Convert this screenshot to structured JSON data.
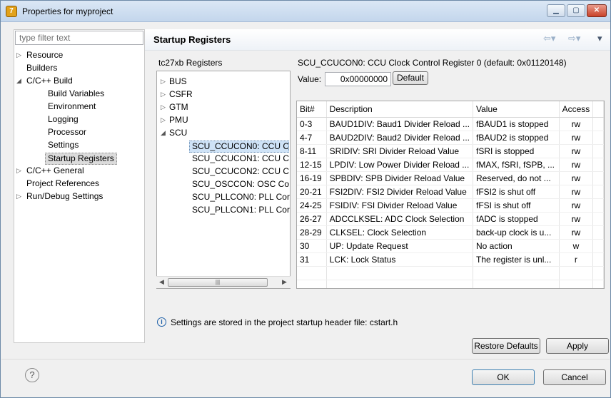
{
  "window": {
    "title": "Properties for myproject"
  },
  "filter": {
    "placeholder": "type filter text"
  },
  "nav_tree": [
    {
      "label": "Resource",
      "expander": "▷"
    },
    {
      "label": "Builders",
      "expander": ""
    },
    {
      "label": "C/C++ Build",
      "expander": "◢"
    },
    {
      "label": "Build Variables",
      "expander": ""
    },
    {
      "label": "Environment",
      "expander": ""
    },
    {
      "label": "Logging",
      "expander": ""
    },
    {
      "label": "Processor",
      "expander": ""
    },
    {
      "label": "Settings",
      "expander": ""
    },
    {
      "label": "Startup Registers",
      "expander": "",
      "selected": true
    },
    {
      "label": "C/C++ General",
      "expander": "▷"
    },
    {
      "label": "Project References",
      "expander": ""
    },
    {
      "label": "Run/Debug Settings",
      "expander": "▷"
    }
  ],
  "page": {
    "title": "Startup Registers"
  },
  "registers": {
    "group_label": "tc27xb Registers",
    "tree": [
      {
        "label": "BUS",
        "expander": "▷"
      },
      {
        "label": "CSFR",
        "expander": "▷"
      },
      {
        "label": "GTM",
        "expander": "▷"
      },
      {
        "label": "PMU",
        "expander": "▷"
      },
      {
        "label": "SCU",
        "expander": "◢"
      },
      {
        "label": "SCU_CCUCON0: CCU C",
        "expander": "",
        "selected": true
      },
      {
        "label": "SCU_CCUCON1: CCU C",
        "expander": ""
      },
      {
        "label": "SCU_CCUCON2: CCU C",
        "expander": ""
      },
      {
        "label": "SCU_OSCCON: OSC Co",
        "expander": ""
      },
      {
        "label": "SCU_PLLCON0: PLL Cor",
        "expander": ""
      },
      {
        "label": "SCU_PLLCON1: PLL Cor",
        "expander": ""
      }
    ]
  },
  "detail": {
    "group_label": "SCU_CCUCON0: CCU Clock Control Register 0 (default: 0x01120148)",
    "value_label": "Value:",
    "value": "0x00000000",
    "default_button": "Default"
  },
  "bit_table": {
    "columns": [
      "Bit#",
      "Description",
      "Value",
      "Access"
    ],
    "rows": [
      [
        "0-3",
        "BAUD1DIV: Baud1 Divider Reload ...",
        "fBAUD1 is stopped",
        "rw"
      ],
      [
        "4-7",
        "BAUD2DIV: Baud2 Divider Reload ...",
        "fBAUD2 is stopped",
        "rw"
      ],
      [
        "8-11",
        "SRIDIV: SRI Divider Reload Value",
        "fSRI is stopped",
        "rw"
      ],
      [
        "12-15",
        "LPDIV: Low Power Divider Reload ...",
        "fMAX, fSRI, fSPB, ...",
        "rw"
      ],
      [
        "16-19",
        "SPBDIV: SPB Divider Reload Value",
        "Reserved, do not ...",
        "rw"
      ],
      [
        "20-21",
        "FSI2DIV: FSI2 Divider Reload Value",
        "fFSI2 is shut off",
        "rw"
      ],
      [
        "24-25",
        "FSIDIV: FSI Divider Reload Value",
        "fFSI is shut off",
        "rw"
      ],
      [
        "26-27",
        "ADCCLKSEL: ADC Clock Selection",
        "fADC is stopped",
        "rw"
      ],
      [
        "28-29",
        "CLKSEL: Clock Selection",
        "back-up clock is u...",
        "rw"
      ],
      [
        "30",
        "UP: Update Request",
        "No action",
        "w"
      ],
      [
        "31",
        "LCK: Lock Status",
        "The register is unl...",
        "r"
      ]
    ]
  },
  "info": {
    "text": "Settings are stored in the project startup header file: cstart.h"
  },
  "buttons": {
    "restore_defaults": "Restore Defaults",
    "apply": "Apply",
    "ok": "OK",
    "cancel": "Cancel"
  }
}
